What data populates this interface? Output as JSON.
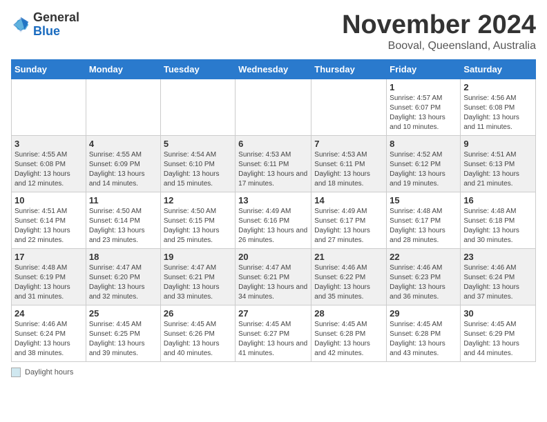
{
  "logo": {
    "general": "General",
    "blue": "Blue"
  },
  "title": "November 2024",
  "subtitle": "Booval, Queensland, Australia",
  "days_of_week": [
    "Sunday",
    "Monday",
    "Tuesday",
    "Wednesday",
    "Thursday",
    "Friday",
    "Saturday"
  ],
  "footer_label": "Daylight hours",
  "weeks": [
    [
      {
        "day": "",
        "sunrise": "",
        "sunset": "",
        "daylight": ""
      },
      {
        "day": "",
        "sunrise": "",
        "sunset": "",
        "daylight": ""
      },
      {
        "day": "",
        "sunrise": "",
        "sunset": "",
        "daylight": ""
      },
      {
        "day": "",
        "sunrise": "",
        "sunset": "",
        "daylight": ""
      },
      {
        "day": "",
        "sunrise": "",
        "sunset": "",
        "daylight": ""
      },
      {
        "day": "1",
        "sunrise": "Sunrise: 4:57 AM",
        "sunset": "Sunset: 6:07 PM",
        "daylight": "Daylight: 13 hours and 10 minutes."
      },
      {
        "day": "2",
        "sunrise": "Sunrise: 4:56 AM",
        "sunset": "Sunset: 6:08 PM",
        "daylight": "Daylight: 13 hours and 11 minutes."
      }
    ],
    [
      {
        "day": "3",
        "sunrise": "Sunrise: 4:55 AM",
        "sunset": "Sunset: 6:08 PM",
        "daylight": "Daylight: 13 hours and 12 minutes."
      },
      {
        "day": "4",
        "sunrise": "Sunrise: 4:55 AM",
        "sunset": "Sunset: 6:09 PM",
        "daylight": "Daylight: 13 hours and 14 minutes."
      },
      {
        "day": "5",
        "sunrise": "Sunrise: 4:54 AM",
        "sunset": "Sunset: 6:10 PM",
        "daylight": "Daylight: 13 hours and 15 minutes."
      },
      {
        "day": "6",
        "sunrise": "Sunrise: 4:53 AM",
        "sunset": "Sunset: 6:11 PM",
        "daylight": "Daylight: 13 hours and 17 minutes."
      },
      {
        "day": "7",
        "sunrise": "Sunrise: 4:53 AM",
        "sunset": "Sunset: 6:11 PM",
        "daylight": "Daylight: 13 hours and 18 minutes."
      },
      {
        "day": "8",
        "sunrise": "Sunrise: 4:52 AM",
        "sunset": "Sunset: 6:12 PM",
        "daylight": "Daylight: 13 hours and 19 minutes."
      },
      {
        "day": "9",
        "sunrise": "Sunrise: 4:51 AM",
        "sunset": "Sunset: 6:13 PM",
        "daylight": "Daylight: 13 hours and 21 minutes."
      }
    ],
    [
      {
        "day": "10",
        "sunrise": "Sunrise: 4:51 AM",
        "sunset": "Sunset: 6:14 PM",
        "daylight": "Daylight: 13 hours and 22 minutes."
      },
      {
        "day": "11",
        "sunrise": "Sunrise: 4:50 AM",
        "sunset": "Sunset: 6:14 PM",
        "daylight": "Daylight: 13 hours and 23 minutes."
      },
      {
        "day": "12",
        "sunrise": "Sunrise: 4:50 AM",
        "sunset": "Sunset: 6:15 PM",
        "daylight": "Daylight: 13 hours and 25 minutes."
      },
      {
        "day": "13",
        "sunrise": "Sunrise: 4:49 AM",
        "sunset": "Sunset: 6:16 PM",
        "daylight": "Daylight: 13 hours and 26 minutes."
      },
      {
        "day": "14",
        "sunrise": "Sunrise: 4:49 AM",
        "sunset": "Sunset: 6:17 PM",
        "daylight": "Daylight: 13 hours and 27 minutes."
      },
      {
        "day": "15",
        "sunrise": "Sunrise: 4:48 AM",
        "sunset": "Sunset: 6:17 PM",
        "daylight": "Daylight: 13 hours and 28 minutes."
      },
      {
        "day": "16",
        "sunrise": "Sunrise: 4:48 AM",
        "sunset": "Sunset: 6:18 PM",
        "daylight": "Daylight: 13 hours and 30 minutes."
      }
    ],
    [
      {
        "day": "17",
        "sunrise": "Sunrise: 4:48 AM",
        "sunset": "Sunset: 6:19 PM",
        "daylight": "Daylight: 13 hours and 31 minutes."
      },
      {
        "day": "18",
        "sunrise": "Sunrise: 4:47 AM",
        "sunset": "Sunset: 6:20 PM",
        "daylight": "Daylight: 13 hours and 32 minutes."
      },
      {
        "day": "19",
        "sunrise": "Sunrise: 4:47 AM",
        "sunset": "Sunset: 6:21 PM",
        "daylight": "Daylight: 13 hours and 33 minutes."
      },
      {
        "day": "20",
        "sunrise": "Sunrise: 4:47 AM",
        "sunset": "Sunset: 6:21 PM",
        "daylight": "Daylight: 13 hours and 34 minutes."
      },
      {
        "day": "21",
        "sunrise": "Sunrise: 4:46 AM",
        "sunset": "Sunset: 6:22 PM",
        "daylight": "Daylight: 13 hours and 35 minutes."
      },
      {
        "day": "22",
        "sunrise": "Sunrise: 4:46 AM",
        "sunset": "Sunset: 6:23 PM",
        "daylight": "Daylight: 13 hours and 36 minutes."
      },
      {
        "day": "23",
        "sunrise": "Sunrise: 4:46 AM",
        "sunset": "Sunset: 6:24 PM",
        "daylight": "Daylight: 13 hours and 37 minutes."
      }
    ],
    [
      {
        "day": "24",
        "sunrise": "Sunrise: 4:46 AM",
        "sunset": "Sunset: 6:24 PM",
        "daylight": "Daylight: 13 hours and 38 minutes."
      },
      {
        "day": "25",
        "sunrise": "Sunrise: 4:45 AM",
        "sunset": "Sunset: 6:25 PM",
        "daylight": "Daylight: 13 hours and 39 minutes."
      },
      {
        "day": "26",
        "sunrise": "Sunrise: 4:45 AM",
        "sunset": "Sunset: 6:26 PM",
        "daylight": "Daylight: 13 hours and 40 minutes."
      },
      {
        "day": "27",
        "sunrise": "Sunrise: 4:45 AM",
        "sunset": "Sunset: 6:27 PM",
        "daylight": "Daylight: 13 hours and 41 minutes."
      },
      {
        "day": "28",
        "sunrise": "Sunrise: 4:45 AM",
        "sunset": "Sunset: 6:28 PM",
        "daylight": "Daylight: 13 hours and 42 minutes."
      },
      {
        "day": "29",
        "sunrise": "Sunrise: 4:45 AM",
        "sunset": "Sunset: 6:28 PM",
        "daylight": "Daylight: 13 hours and 43 minutes."
      },
      {
        "day": "30",
        "sunrise": "Sunrise: 4:45 AM",
        "sunset": "Sunset: 6:29 PM",
        "daylight": "Daylight: 13 hours and 44 minutes."
      }
    ]
  ]
}
